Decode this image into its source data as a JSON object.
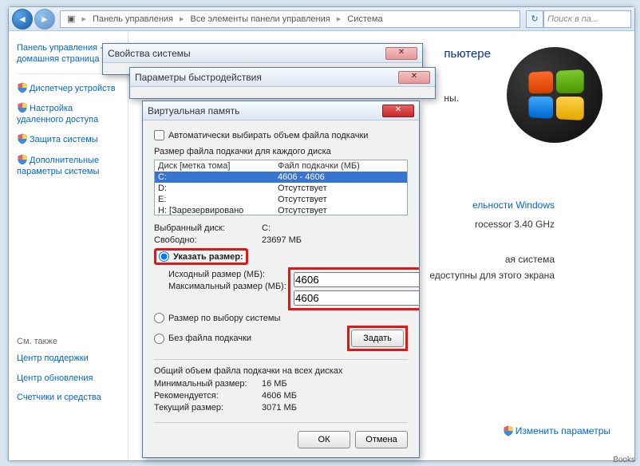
{
  "breadcrumb": {
    "p1": "Панель управления",
    "p2": "Все элементы панели управления",
    "p3": "Система"
  },
  "search": {
    "placeholder": "Поиск в па..."
  },
  "sidebar": {
    "home": "Панель управления - домашняя страница",
    "links": [
      "Диспетчер устройств",
      "Настройка удаленного доступа",
      "Защита системы",
      "Дополнительные параметры системы"
    ],
    "see_also": "См. также",
    "bottom_links": [
      "Центр поддержки",
      "Центр обновления",
      "Счетчики и средства"
    ]
  },
  "content": {
    "heading_suffix": "пьютере",
    "line1_suffix": "ны.",
    "rating_link": "ельности Windows",
    "proc_suffix": "rocessor   3.40 GHz",
    "sys_suffix": "ая система",
    "touch_suffix": "едоступны для этого экрана",
    "change_params": "Изменить параметры"
  },
  "dlg1": {
    "title": "Свойства системы"
  },
  "dlg2": {
    "title": "Параметры быстродействия"
  },
  "dlg3": {
    "title": "Виртуальная память",
    "auto_manage": "Автоматически выбирать объем файла подкачки",
    "group_label": "Размер файла подкачки для каждого диска",
    "col1": "Диск [метка тома]",
    "col2": "Файл подкачки (МБ)",
    "drives": [
      {
        "d": "C:",
        "v": "4606 - 4606",
        "sel": true
      },
      {
        "d": "D:",
        "v": "Отсутствует"
      },
      {
        "d": "E:",
        "v": "Отсутствует"
      },
      {
        "d": "H:     [Зарезервировано системой]",
        "v": "Отсутствует"
      }
    ],
    "selected_drive_lbl": "Выбранный диск:",
    "selected_drive_val": "C:",
    "free_lbl": "Свободно:",
    "free_val": "23697 МБ",
    "radio_custom": "Указать размер:",
    "initial_lbl": "Исходный размер (МБ):",
    "initial_val": "4606",
    "max_lbl": "Максимальный размер (МБ):",
    "max_val": "4606",
    "radio_system": "Размер по выбору системы",
    "radio_none": "Без файла подкачки",
    "set_btn": "Задать",
    "total_label": "Общий объем файла подкачки на всех дисках",
    "min_lbl": "Минимальный размер:",
    "min_val": "16 МБ",
    "rec_lbl": "Рекомендуется:",
    "rec_val": "4606 МБ",
    "cur_lbl": "Текущий размер:",
    "cur_val": "3071 МБ",
    "ok": "ОК",
    "cancel": "Отмена"
  },
  "books": "Books"
}
